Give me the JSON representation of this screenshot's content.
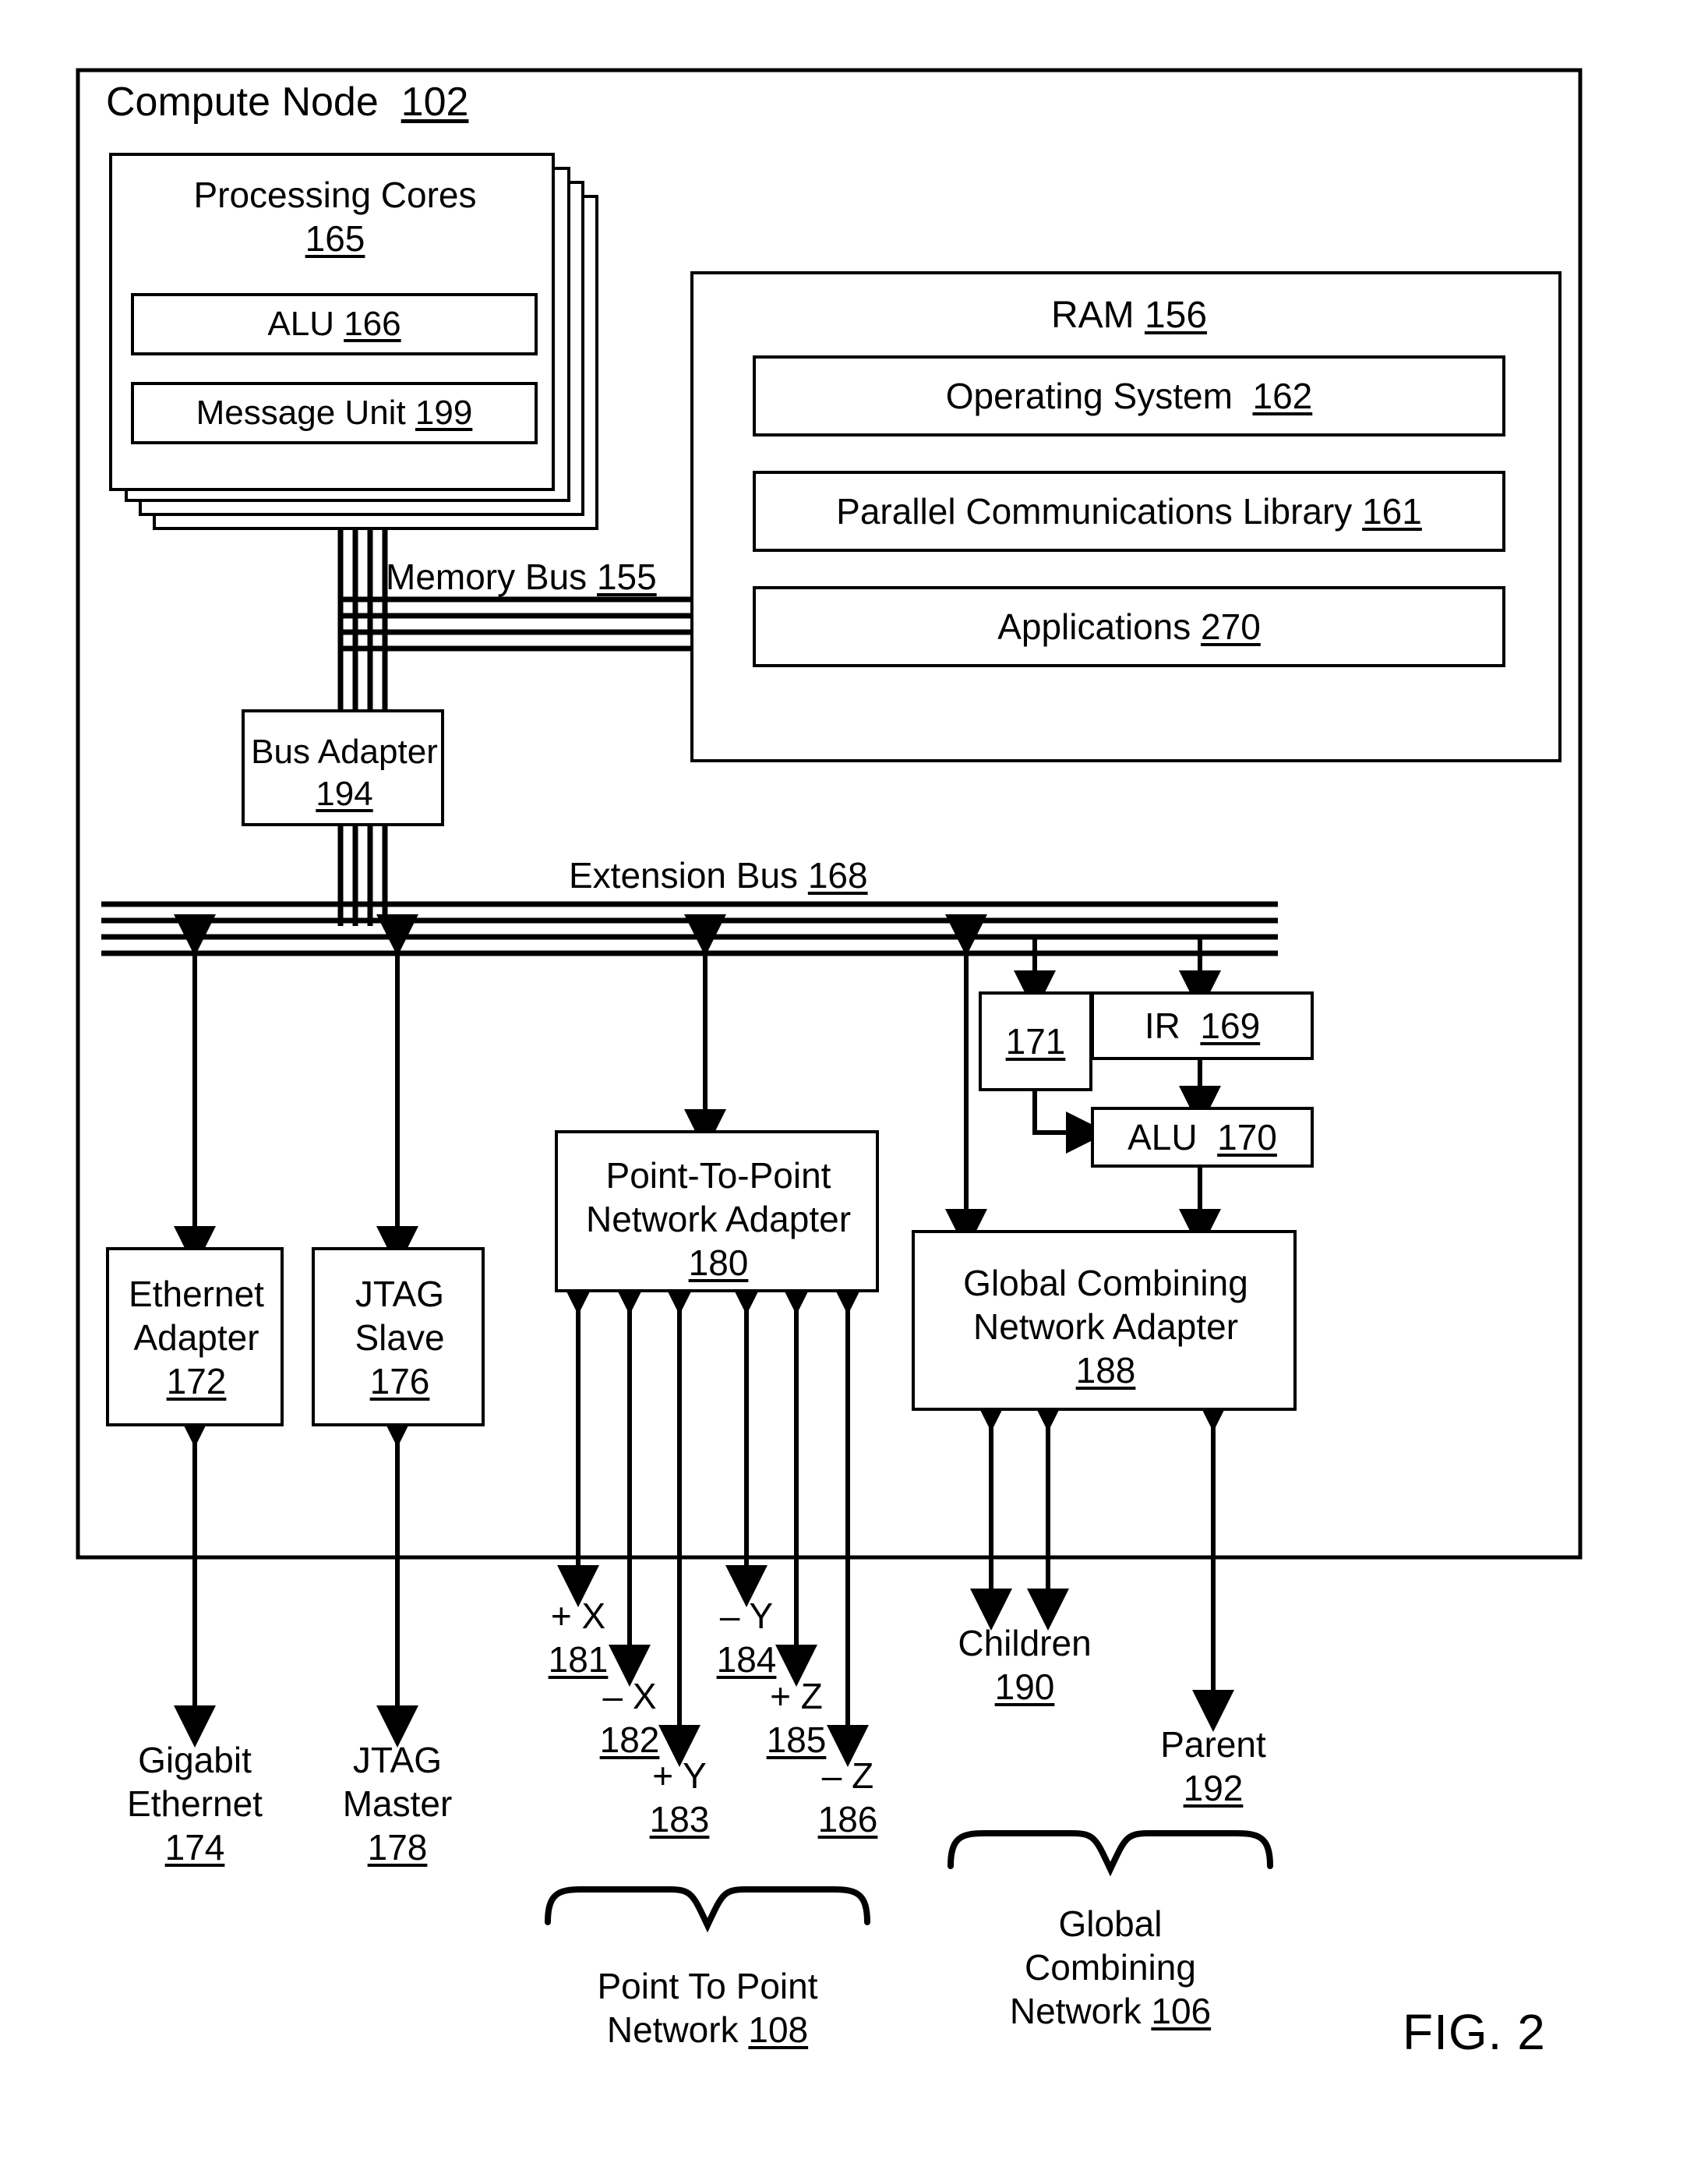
{
  "figure": {
    "caption": "FIG. 2"
  },
  "compute_node": {
    "label": "Compute Node",
    "ref": "102"
  },
  "processing_cores": {
    "label": "Processing Cores",
    "ref": "165",
    "stack_count": 4,
    "alu": {
      "label": "ALU",
      "ref": "166"
    },
    "message_unit": {
      "label": "Message Unit",
      "ref": "199"
    }
  },
  "ram": {
    "label": "RAM",
    "ref": "156",
    "items": [
      {
        "label": "Operating System",
        "ref": "162"
      },
      {
        "label": "Parallel Communications Library",
        "ref": "161"
      },
      {
        "label": "Applications",
        "ref": "270"
      }
    ]
  },
  "memory_bus": {
    "label": "Memory Bus",
    "ref": "155"
  },
  "bus_adapter": {
    "label": "Bus Adapter",
    "ref": "194"
  },
  "extension_bus": {
    "label": "Extension Bus",
    "ref": "168"
  },
  "ethernet_adapter": {
    "label": "Ethernet\nAdapter",
    "ref": "172"
  },
  "jtag_slave": {
    "label": "JTAG\nSlave",
    "ref": "176"
  },
  "p2p_adapter": {
    "label": "Point-To-Point\nNetwork Adapter",
    "ref": "180"
  },
  "global_combining_adapter": {
    "label": "Global Combining\nNetwork Adapter",
    "ref": "188"
  },
  "register_171": {
    "ref": "171"
  },
  "ir": {
    "label": "IR",
    "ref": "169"
  },
  "alu_170": {
    "label": "ALU",
    "ref": "170"
  },
  "endpoints": {
    "gigabit_ethernet": {
      "label": "Gigabit\nEthernet",
      "ref": "174"
    },
    "jtag_master": {
      "label": "JTAG\nMaster",
      "ref": "178"
    },
    "children": {
      "label": "Children",
      "ref": "190"
    },
    "parent": {
      "label": "Parent",
      "ref": "192"
    }
  },
  "torus_links": [
    {
      "label": "+ X",
      "ref": "181"
    },
    {
      "label": "– X",
      "ref": "182"
    },
    {
      "label": "+ Y",
      "ref": "183"
    },
    {
      "label": "– Y",
      "ref": "184"
    },
    {
      "label": "+ Z",
      "ref": "185"
    },
    {
      "label": "– Z",
      "ref": "186"
    }
  ],
  "networks": {
    "point_to_point": {
      "label": "Point To Point\nNetwork",
      "ref": "108"
    },
    "global_combining": {
      "label": "Global\nCombining\nNetwork",
      "ref": "106"
    }
  }
}
